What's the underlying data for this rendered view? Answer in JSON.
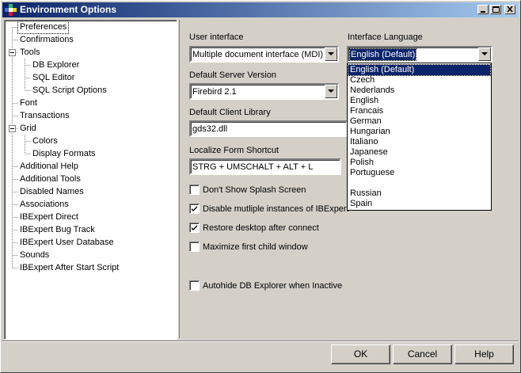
{
  "window": {
    "title": "Environment Options"
  },
  "tree": {
    "items": [
      {
        "label": "Preferences"
      },
      {
        "label": "Confirmations"
      },
      {
        "label": "Tools"
      },
      {
        "label": "DB Explorer"
      },
      {
        "label": "SQL Editor"
      },
      {
        "label": "SQL Script Options"
      },
      {
        "label": "Font"
      },
      {
        "label": "Transactions"
      },
      {
        "label": "Grid"
      },
      {
        "label": "Colors"
      },
      {
        "label": "Display Formats"
      },
      {
        "label": "Additional Help"
      },
      {
        "label": "Additional Tools"
      },
      {
        "label": "Disabled Names"
      },
      {
        "label": "Associations"
      },
      {
        "label": "IBExpert Direct"
      },
      {
        "label": "IBExpert Bug Track"
      },
      {
        "label": "IBExpert User Database"
      },
      {
        "label": "Sounds"
      },
      {
        "label": "IBExpert After Start Script"
      }
    ]
  },
  "form": {
    "user_interface": {
      "label": "User interface",
      "value": "Multiple document interface (MDI)"
    },
    "interface_language": {
      "label": "Interface Language",
      "value": "English (Default)",
      "options": [
        "English (Default)",
        "Czech",
        "Nederlands",
        "English",
        "Francais",
        "German",
        "Hungarian",
        "Italiano",
        "Japanese",
        "Polish",
        "Portuguese",
        "",
        "Russian",
        "Spain"
      ]
    },
    "server_version": {
      "label": "Default Server Version",
      "value": "Firebird 2.1"
    },
    "client_library": {
      "label": "Default Client Library",
      "value": "gds32.dll"
    },
    "localize_shortcut": {
      "label": "Localize Form Shortcut",
      "value": "STRG + UMSCHALT + ALT + L"
    },
    "checkboxes": [
      {
        "label": "Don't Show Splash Screen",
        "checked": false
      },
      {
        "label": "Disable mutliple instances of IBExpert",
        "checked": true
      },
      {
        "label": "Restore desktop after connect",
        "checked": true
      },
      {
        "label": "Maximize first child window",
        "checked": false
      },
      {
        "label": "Autohide DB Explorer when Inactive",
        "checked": false
      }
    ]
  },
  "buttons": {
    "ok": "OK",
    "cancel": "Cancel",
    "help": "Help"
  },
  "colors": {
    "titlebar_start": "#0a246a",
    "titlebar_end": "#a6caf0",
    "face": "#d4d0c8",
    "selection": "#0a246a"
  }
}
